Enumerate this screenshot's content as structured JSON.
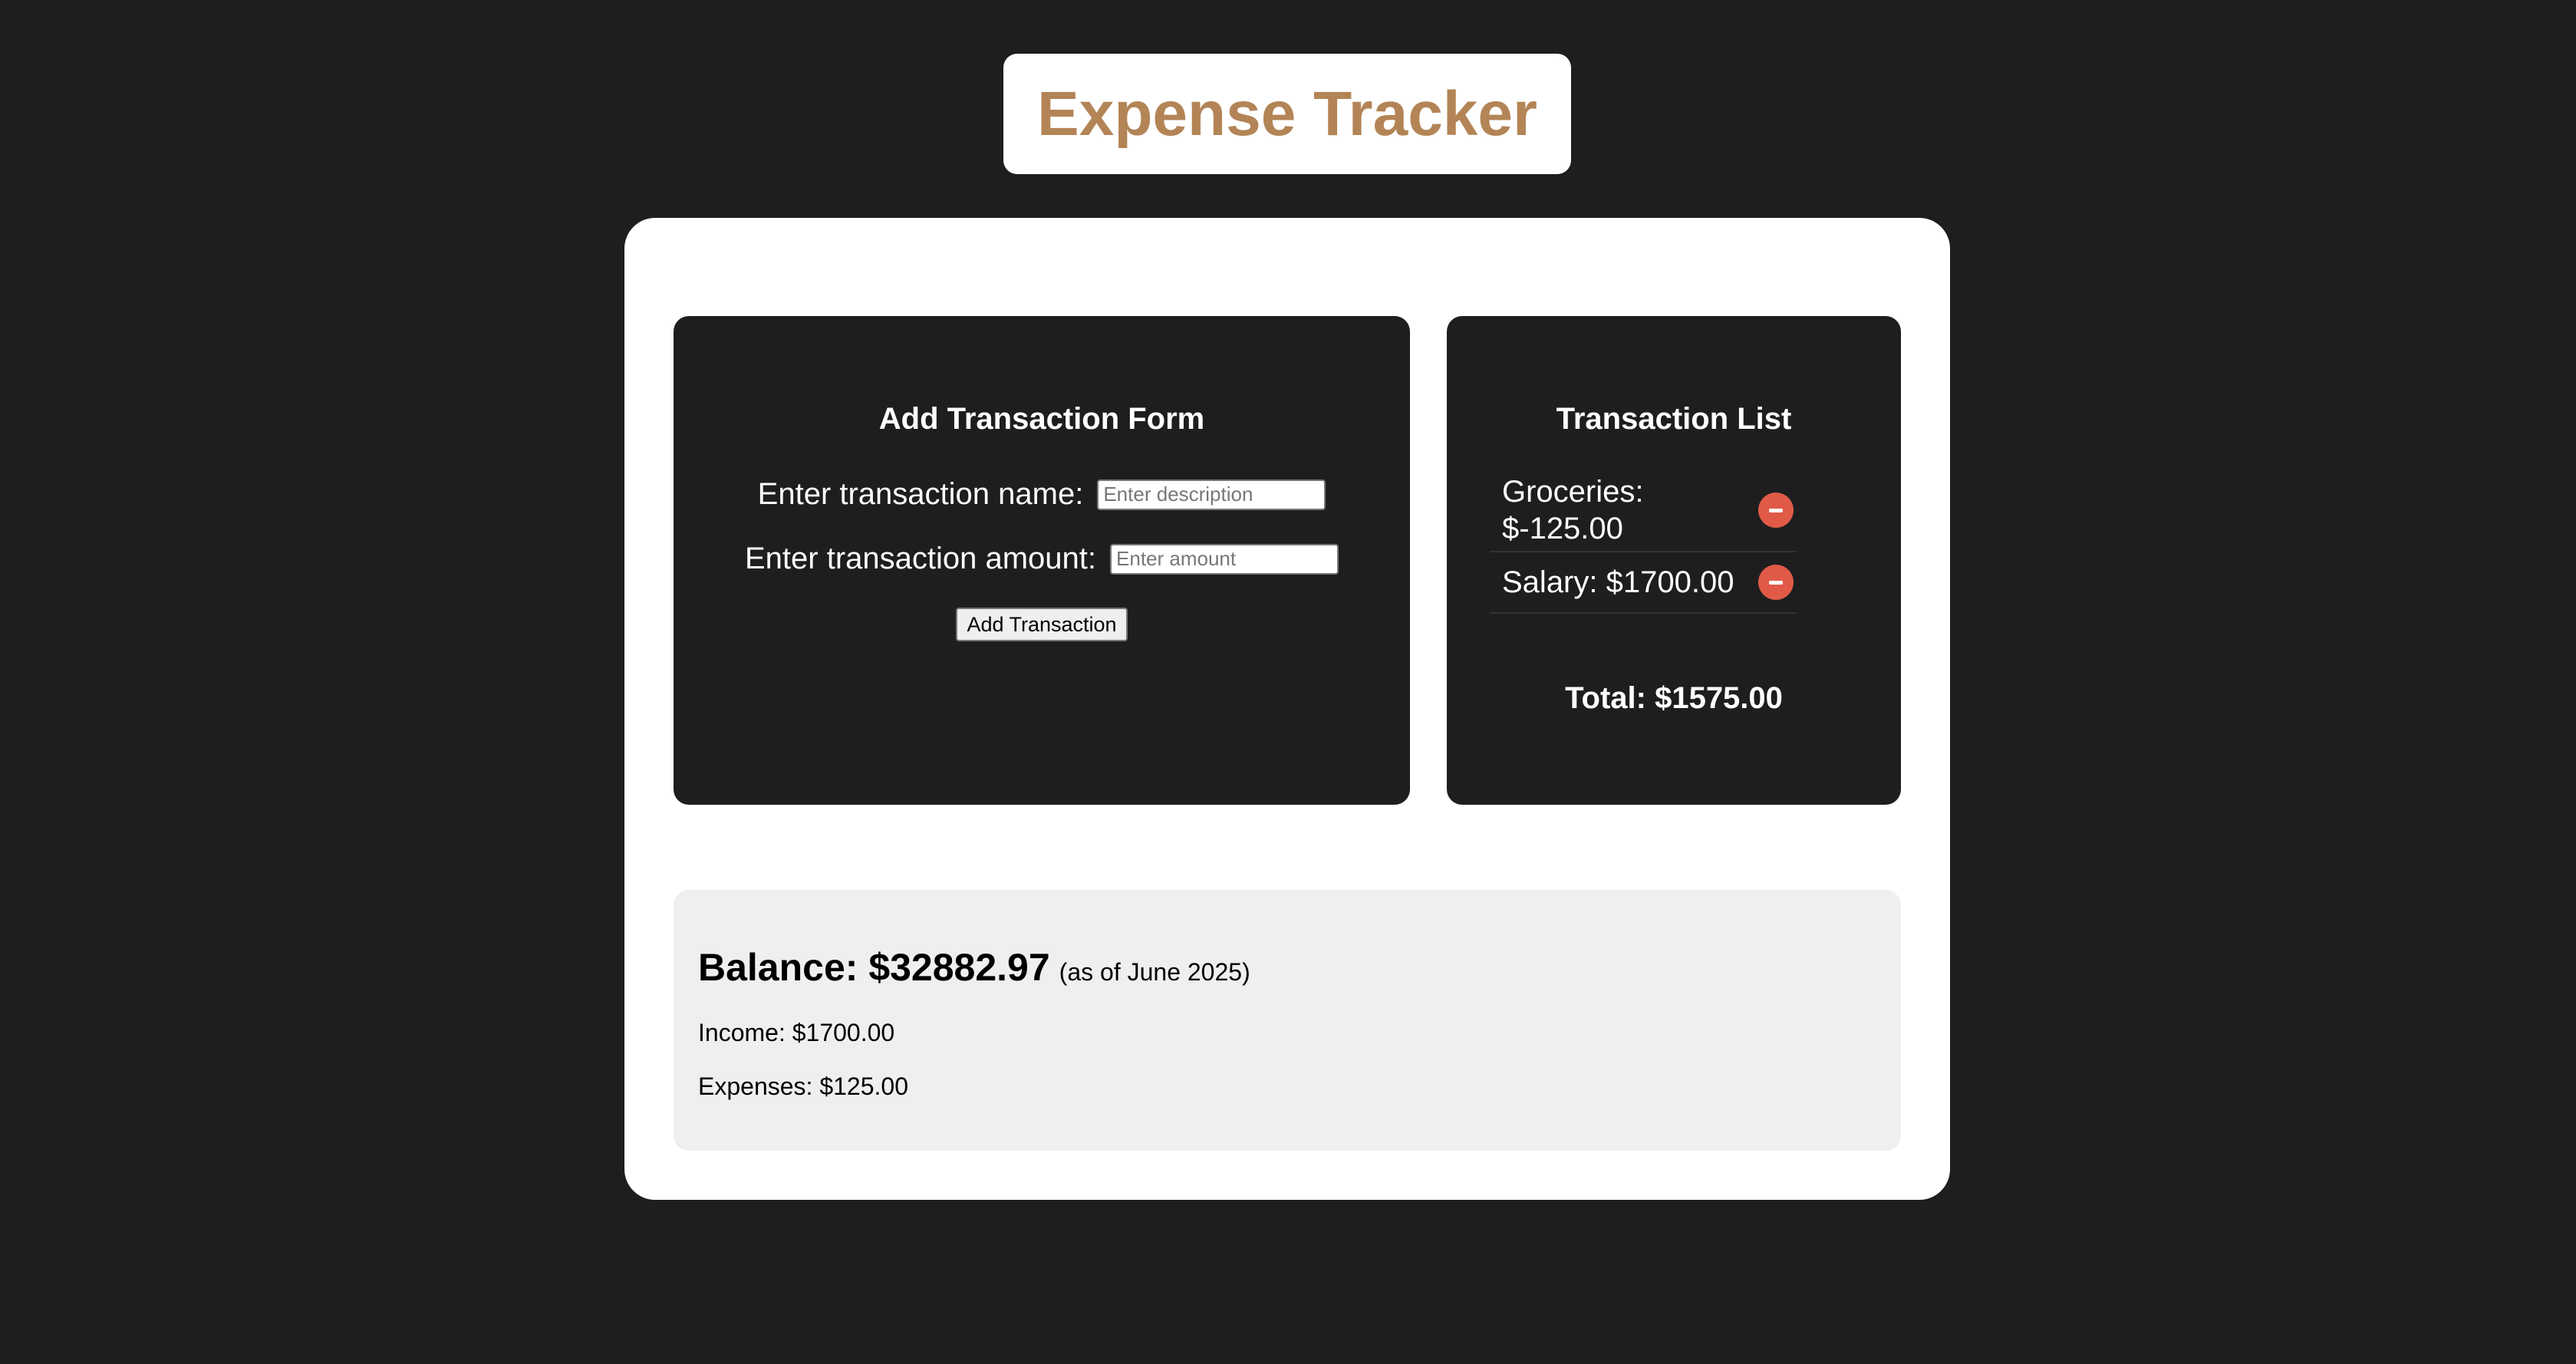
{
  "header": {
    "title": "Expense Tracker"
  },
  "form": {
    "heading": "Add Transaction Form",
    "name_label": "Enter transaction name:",
    "name_placeholder": "Enter description",
    "amount_label": "Enter transaction amount:",
    "amount_placeholder": "Enter amount",
    "submit_label": "Add Transaction"
  },
  "transactions": {
    "heading": "Transaction List",
    "items": [
      {
        "text": "Groceries: $-125.00"
      },
      {
        "text": "Salary: $1700.00"
      }
    ],
    "total": "Total: $1575.00"
  },
  "summary": {
    "balance": "Balance: $32882.97",
    "balance_note": "(as of June 2025)",
    "income": "Income: $1700.00",
    "expenses": "Expenses: $125.00"
  },
  "colors": {
    "background": "#1e1e1e",
    "title_accent": "#b38456",
    "delete_button": "#e05a47",
    "summary_background": "#efefef"
  },
  "icons": {
    "delete": "minus-circle-icon"
  }
}
